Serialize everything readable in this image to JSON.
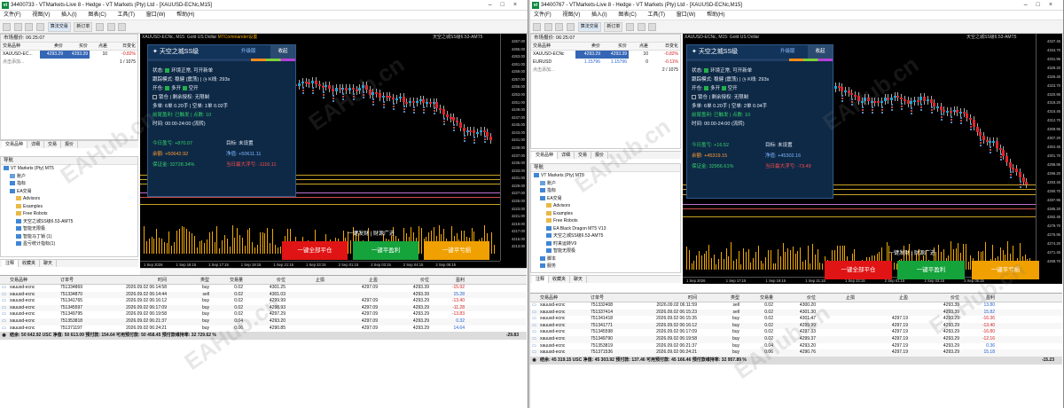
{
  "windows": [
    {
      "title": "34400733 - VTMarkets-Live 8 - Hedge - VT Markets (Pty) Ltd - [XAUUSD-ECNc,M15]",
      "menu": [
        "文件(F)",
        "视图(V)",
        "插入(I)",
        "图表(C)",
        "工具(T)",
        "窗口(W)",
        "帮助(H)"
      ],
      "toolbar": {
        "trading": "算法交易",
        "new_order": "新订单"
      },
      "market_watch": {
        "title": "市场报价: 06:25:07",
        "headers": [
          "交易品种",
          "卖价",
          "买价",
          "点差",
          "日变化"
        ],
        "rows": [
          {
            "symbol": "XAUUSD-EC...",
            "bid": "4293.29",
            "ask": "4293.39",
            "spread": "10",
            "change": "-0.82%"
          }
        ],
        "add_hint": "点击添加...",
        "count": "1 / 1075",
        "tabs": [
          "交易品种",
          "详细",
          "交易",
          "报价"
        ]
      },
      "navigator": {
        "title": "导航",
        "items": [
          {
            "label": "VT Markets (Pty) MT5",
            "indent": 0,
            "icon": "terminal-icon"
          },
          {
            "label": "账户",
            "indent": 1,
            "icon": "account-icon"
          },
          {
            "label": "指标",
            "indent": 1,
            "icon": "indicator-icon"
          },
          {
            "label": "EA交易",
            "indent": 1,
            "icon": "ea-icon"
          },
          {
            "label": "Advisors",
            "indent": 2,
            "icon": "folder-icon"
          },
          {
            "label": "Examples",
            "indent": 2,
            "icon": "folder-icon"
          },
          {
            "label": "Free Robots",
            "indent": 2,
            "icon": "folder-icon"
          },
          {
            "label": "天空之城SS级6.53-AMT5",
            "indent": 2,
            "icon": "ea-icon"
          },
          {
            "label": "智能无限极",
            "indent": 2,
            "icon": "ea-icon"
          },
          {
            "label": "智能马丁锁 (1)",
            "indent": 2,
            "icon": "ea-icon"
          },
          {
            "label": "盈亏统计指标(1)",
            "indent": 2,
            "icon": "ea-icon"
          }
        ],
        "tabs": [
          "注释",
          "收藏夹",
          "聊天"
        ]
      },
      "chart": {
        "title": "XAUUSD-ECNc, M15: Gold US Dollar",
        "subtitle": "天空之城SS级6.53-AMT5",
        "sub2": "MTCommander设置",
        "y_ticks": [
          "4267.00",
          "4265.00",
          "4263.00",
          "4261.00",
          "4259.00",
          "4257.00",
          "4255.00",
          "4253.00",
          "4251.00",
          "4249.00",
          "4247.00",
          "4245.00",
          "4243.00",
          "4241.00",
          "4239.00",
          "4237.00",
          "4235.00",
          "4233.00",
          "4231.00",
          "4229.00",
          "4227.00",
          "4225.00",
          "4223.00",
          "4221.00",
          "4219.00",
          "4217.00",
          "4215.00",
          "4213.00"
        ],
        "x_ticks": [
          "1 Sep 2026",
          "1 Sep 16:15",
          "1 Sep 17:15",
          "1 Sep 19:15",
          "1 Sep 21:15",
          "1 Sep 23:15",
          "2 Sep 01:15",
          "2 Sep 03:15",
          "2 Sep 04:15",
          "2 Sep 05:15"
        ]
      },
      "ea_panel": {
        "name": "天空之城SS级",
        "upgrade": "升级版",
        "collapse": "收起",
        "status": "状态:",
        "status_val": "环境正常, 可开新单",
        "mode_label": "跟踪模式:",
        "mode_val": "稳健 (震荡)",
        "k_label": "K线: 293s",
        "open_label": "开仓:",
        "long": "多开",
        "short": "空开",
        "lock": "锁仓",
        "auth": "剩余授权: 无限制",
        "positions": "多单: 6单 0.20手 | 空单: 1单 0.02手",
        "take_profit": "前尾盈利: 已触发 | 点数: 10",
        "time": "时间:",
        "time_val": "00:00-24:00 (流转)",
        "today_profit_label": "今日盈亏:",
        "today_profit": "+870.07",
        "target_label": "目标:",
        "target": "未设置",
        "balance_label": "余额:",
        "balance": "+50642.92",
        "equity_label": "净值:",
        "equity": "+50611.11",
        "margin_label": "保证金:",
        "margin": "32728.34%",
        "maxdd_label": "当日最大浮亏:",
        "maxdd": "-1116.11"
      },
      "midlabel": "一键发财 | 财源广进",
      "buttons": {
        "close_all": "一键全部平仓",
        "close_profit": "一键平盈利",
        "close_loss": "一键平亏损"
      },
      "terminal": {
        "headers": [
          "交易品种",
          "订单号",
          "时间",
          "类型",
          "交易量",
          "价位",
          "止损",
          "止盈",
          "价位",
          "盈利"
        ],
        "rows": [
          [
            "xauusd-ecnc",
            "751334869",
            "2026.09.02 06:14:58",
            "buy",
            "0.02",
            "4301.25",
            "",
            "4297.09",
            "4293.39",
            "-15.92"
          ],
          [
            "xauusd-ecnc",
            "751334870",
            "2026.09.02 06:14:44",
            "sell",
            "0.02",
            "4301.03",
            "",
            "",
            "4293.39",
            "15.28"
          ],
          [
            "xauusd-ecnc",
            "751341765",
            "2026.09.02 06:16:12",
            "buy",
            "0.02",
            "4299.99",
            "",
            "4297.09",
            "4293.29",
            "-13.40"
          ],
          [
            "xauusd-ecnc",
            "751345597",
            "2026.09.02 06:17:09",
            "buy",
            "0.02",
            "4298.93",
            "",
            "4297.09",
            "4293.29",
            "-11.28"
          ],
          [
            "xauusd-ecnc",
            "751349795",
            "2026.09.02 06:19:58",
            "buy",
            "0.02",
            "4297.29",
            "",
            "4297.09",
            "4293.29",
            "-13.83"
          ],
          [
            "xauusd-ecnc",
            "751353818",
            "2026.09.02 06:21:37",
            "buy",
            "0.04",
            "4293.20",
            "",
            "4297.09",
            "4293.29",
            "0.32"
          ],
          [
            "xauusd-ecnc",
            "751371197",
            "2026.09.02 06:24:21",
            "buy",
            "0.06",
            "4290.85",
            "",
            "4297.09",
            "4293.29",
            "14.64"
          ]
        ],
        "footer": "结余: 50 642.92 USC  净值: 50 613.09  预付款: 154.64  可用预付款: 50 458.45  预付款维持率: 32 729.62 %",
        "footer_total": "-29.83",
        "tabs": [
          "交易",
          "敞口",
          "历史",
          "新闻",
          "邮箱",
          "日历",
          "公司",
          "警报",
          "文章",
          "代码库",
          "专家",
          "日志"
        ]
      }
    },
    {
      "title": "34400767 - VTMarkets-Live 8 - Hedge - VT Markets (Pty) Ltd - [XAUUSD-ECNc,M15]",
      "menu": [
        "文件(F)",
        "视图(V)",
        "插入(I)",
        "图表(C)",
        "工具(T)",
        "窗口(W)",
        "帮助(H)"
      ],
      "toolbar": {
        "trading": "算法交易",
        "new_order": "新订单"
      },
      "market_watch": {
        "title": "市场报价: 06:25:07",
        "headers": [
          "交易品种",
          "卖价",
          "买价",
          "点差",
          "日变化"
        ],
        "rows": [
          {
            "symbol": "XAUUSD-ECNc",
            "bid": "4293.29",
            "ask": "4293.39",
            "spread": "10",
            "change": "-0.82%"
          },
          {
            "symbol": "EURUSD",
            "bid": "1.15796",
            "ask": "1.15796",
            "spread": "0",
            "change": "-0.11%"
          }
        ],
        "add_hint": "点击添加...",
        "count": "2 / 1075",
        "tabs": [
          "交易品种",
          "详细",
          "交易",
          "报价"
        ]
      },
      "navigator": {
        "title": "导航",
        "items": [
          {
            "label": "VT Markets (Pty) MT5",
            "indent": 0,
            "icon": "terminal-icon"
          },
          {
            "label": "账户",
            "indent": 1,
            "icon": "account-icon"
          },
          {
            "label": "指标",
            "indent": 1,
            "icon": "indicator-icon"
          },
          {
            "label": "EA交易",
            "indent": 1,
            "icon": "ea-icon"
          },
          {
            "label": "Advisors",
            "indent": 2,
            "icon": "folder-icon"
          },
          {
            "label": "Examples",
            "indent": 2,
            "icon": "folder-icon"
          },
          {
            "label": "Free Robots",
            "indent": 2,
            "icon": "folder-icon"
          },
          {
            "label": "EA Black Dragon MT5 V13",
            "indent": 2,
            "icon": "ea-icon"
          },
          {
            "label": "天空之城SS级6.53-AMT5",
            "indent": 2,
            "icon": "ea-icon"
          },
          {
            "label": "时来运转V9",
            "indent": 2,
            "icon": "ea-icon"
          },
          {
            "label": "智能无限极",
            "indent": 2,
            "icon": "ea-icon"
          },
          {
            "label": "脚本",
            "indent": 1,
            "icon": "script-icon"
          },
          {
            "label": "服务",
            "indent": 1,
            "icon": "service-icon"
          }
        ],
        "tabs": [
          "注释",
          "收藏夹",
          "聊天"
        ]
      },
      "chart": {
        "title": "XAUUSD-ECNc, M15: Gold US Dollar",
        "subtitle": "天空之城SS级6.53-AMT5",
        "sub2": "",
        "y_ticks": [
          "4337.45",
          "4334.70",
          "4331.95",
          "4329.20",
          "4326.45",
          "4323.70",
          "4320.95",
          "4318.20",
          "4315.45",
          "4312.70",
          "4309.95",
          "4307.20",
          "4304.45",
          "4301.70",
          "4298.95",
          "4296.20",
          "4293.45",
          "4290.70",
          "4287.95",
          "4285.20",
          "4282.45",
          "4279.70",
          "4276.95",
          "4274.20",
          "4271.45",
          "4268.70"
        ],
        "x_ticks": [
          "1 Sep 2026",
          "1 Sep 17:15",
          "1 Sep 19:15",
          "1 Sep 21:15",
          "1 Sep 23:15",
          "2 Sep 01:15",
          "2 Sep 03:15",
          "2 Sep 05:15"
        ]
      },
      "ea_panel": {
        "name": "天空之城SS级",
        "upgrade": "升级版",
        "collapse": "收起",
        "status": "状态:",
        "status_val": "环境正常, 可开新单",
        "mode_label": "跟踪模式:",
        "mode_val": "稳健 (震荡)",
        "k_label": "K线: 293s",
        "open_label": "开仓:",
        "long": "多开",
        "short": "空开",
        "lock": "锁仓",
        "auth": "剩余授权: 无限制",
        "positions": "多单: 6单 0.20手 | 空单: 2单 0.04手",
        "take_profit": "前尾盈利: 已触发 | 点数: 10",
        "time": "时间:",
        "time_val": "00:00-24:00 (流转)",
        "today_profit_label": "今日盈亏:",
        "today_profit": "+16.52",
        "target_label": "目标:",
        "target": "未设置",
        "balance_label": "余额:",
        "balance": "+45319.15",
        "equity_label": "净值:",
        "equity": "+45302.16",
        "margin_label": "保证金:",
        "margin": "32956.61%",
        "maxdd_label": "当日最大浮亏:",
        "maxdd": "-73.49"
      },
      "midlabel": "一键发财 | 财源广进",
      "buttons": {
        "close_all": "一键全部平仓",
        "close_profit": "一键平盈利",
        "close_loss": "一键平亏损"
      },
      "terminal": {
        "headers": [
          "交易品种",
          "订单号",
          "时间",
          "类型",
          "交易量",
          "价位",
          "止损",
          "止盈",
          "价位",
          "盈利"
        ],
        "rows": [
          [
            "xauusd-ecnc",
            "751332408",
            "2026.09.02 06:11:59",
            "sell",
            "0.02",
            "4300.20",
            "",
            "",
            "4293.39",
            "13.80"
          ],
          [
            "xauusd-ecnc",
            "751337414",
            "2026.09.02 06:15:23",
            "sell",
            "0.02",
            "4301.30",
            "",
            "",
            "4293.39",
            "15.82"
          ],
          [
            "xauusd-ecnc",
            "751341418",
            "2026.09.02 06:15:35",
            "buy",
            "0.02",
            "4301.47",
            "",
            "4297.19",
            "4293.29",
            "-16.36"
          ],
          [
            "xauusd-ecnc",
            "751341771",
            "2026.09.02 06:16:12",
            "buy",
            "0.02",
            "4299.99",
            "",
            "4297.19",
            "4293.29",
            "-13.40"
          ],
          [
            "xauusd-ecnc",
            "751345598",
            "2026.09.02 06:17:09",
            "buy",
            "0.02",
            "4297.33",
            "",
            "4297.19",
            "4293.29",
            "-16.80"
          ],
          [
            "xauusd-ecnc",
            "751349790",
            "2026.09.02 06:19:58",
            "buy",
            "0.02",
            "4299.37",
            "",
            "4297.19",
            "4293.29",
            "-12.16"
          ],
          [
            "xauusd-ecnc",
            "751353819",
            "2026.09.02 06:21:37",
            "buy",
            "0.04",
            "4293.20",
            "",
            "4297.19",
            "4293.29",
            "0.36"
          ],
          [
            "xauusd-ecnc",
            "751371536",
            "2026.09.02 06:24:21",
            "buy",
            "0.06",
            "4290.76",
            "",
            "4297.19",
            "4293.29",
            "15.18"
          ]
        ],
        "footer": "结余: 45 319.15 USC  净值: 45 303.92  预付款: 137.46  可用预付款: 45 166.46  预付款维持率: 32 957.89 %",
        "footer_total": "-15.23",
        "tabs": [
          "交易",
          "敞口",
          "历史",
          "新闻",
          "邮箱",
          "日历",
          "公司",
          "警报",
          "文章",
          "代码库",
          "专家",
          "日志"
        ]
      }
    }
  ],
  "watermark": "EAHub.cn",
  "colors": {
    "bid_bg": "#3566b5",
    "neg": "#d62020",
    "pos": "#1e5fd0",
    "btn_red": "#e01414",
    "btn_green": "#15a33b",
    "btn_orange": "#f0a000",
    "ea_bg": "#0e2946"
  }
}
